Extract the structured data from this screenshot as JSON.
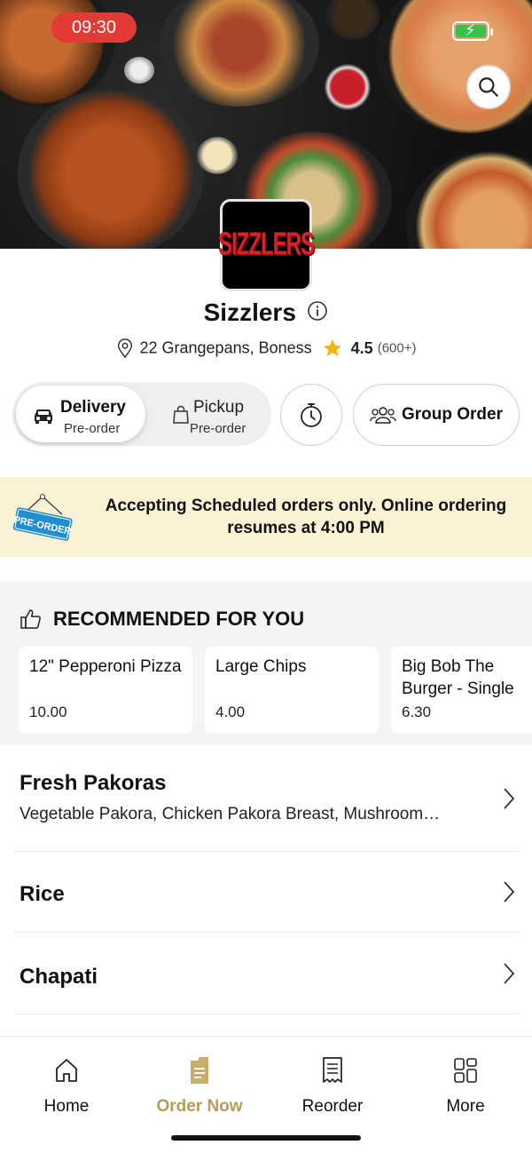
{
  "status_bar": {
    "time": "09:30"
  },
  "restaurant": {
    "logo_text": "SIZZLERS",
    "name": "Sizzlers",
    "address": "22 Grangepans, Boness",
    "rating": "4.5",
    "rating_count": "(600+)"
  },
  "order_mode": {
    "delivery": {
      "label": "Delivery",
      "sub": "Pre-order"
    },
    "pickup": {
      "label": "Pickup",
      "sub": "Pre-order"
    },
    "group_order_label": "Group Order"
  },
  "banner": {
    "sign_text": "PRE-ORDER",
    "message": "Accepting Scheduled orders only. Online ordering resumes at 4:00 PM"
  },
  "recommended": {
    "heading": "RECOMMENDED FOR YOU",
    "items": [
      {
        "name": "12\" Pepperoni Pizza",
        "price": "10.00"
      },
      {
        "name": "Large Chips",
        "price": "4.00"
      },
      {
        "name": "Big Bob The Burger - Single",
        "price": "6.30"
      }
    ]
  },
  "menu_sections": [
    {
      "title": "Fresh Pakoras",
      "desc": "Vegetable Pakora, Chicken Pakora Breast, Mushroom…"
    },
    {
      "title": "Rice",
      "desc": ""
    },
    {
      "title": "Chapati",
      "desc": ""
    }
  ],
  "bottom_nav": [
    {
      "label": "Home",
      "icon": "home-icon"
    },
    {
      "label": "Order Now",
      "icon": "order-bag-icon"
    },
    {
      "label": "Reorder",
      "icon": "receipt-icon"
    },
    {
      "label": "More",
      "icon": "grid-icon"
    }
  ],
  "colors": {
    "accent_gold": "#b69c5a",
    "status_red": "#e23b36",
    "banner_bg": "#fbf1d4",
    "star": "#f5b400",
    "logo_red": "#d3222a"
  }
}
